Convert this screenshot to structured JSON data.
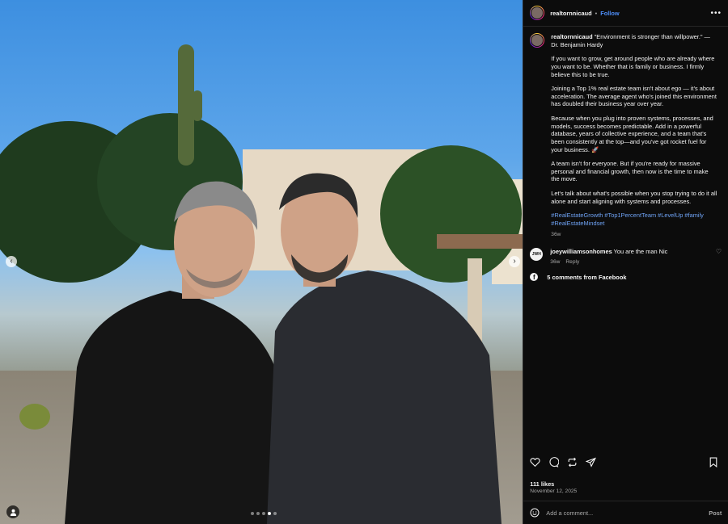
{
  "header": {
    "username": "realtornnicaud",
    "separator": "•",
    "follow_label": "Follow",
    "more_label": "•••"
  },
  "caption": {
    "username": "realtornnicaud",
    "quote": "\"Environment is stronger than willpower.\" — Dr. Benjamin Hardy",
    "paragraphs": [
      "If you want to grow, get around people who are already where you want to be. Whether that is family or business. I firmly believe this to be true.",
      "Joining a Top 1% real estate team isn't about ego — it's about acceleration. The average agent who's joined this environment has doubled their business year over year.",
      "Because when you plug into proven systems, processes, and models, success becomes predictable. Add in a powerful database, years of collective experience, and a team that's been consistently at the top—and you've got rocket fuel for your business. 🚀",
      "A team isn't for everyone. But if you're ready for massive personal and financial growth, then now is the time to make the move.",
      "Let's talk about what's possible when you stop trying to do it all alone and start aligning with systems and processes."
    ],
    "hashtags": "#RealEstateGrowth #Top1PercentTeam #LevelUp #family #RealEstateMindset",
    "age": "36w"
  },
  "comments": [
    {
      "avatar_text": "JWH",
      "username": "joeywilliamsonhomes",
      "text": "You are the man Nic",
      "age": "36w",
      "reply_label": "Reply"
    }
  ],
  "facebook": {
    "label": "5 comments from Facebook",
    "icon": "facebook-icon"
  },
  "actions": {
    "icons": [
      "heart-icon",
      "comment-icon",
      "share-icon",
      "send-icon",
      "bookmark-icon"
    ]
  },
  "stats": {
    "likes": "111 likes",
    "date": "November 12, 2025"
  },
  "add_comment": {
    "placeholder": "Add a comment...",
    "post_label": "Post"
  },
  "photo": {
    "nav_prev": "‹",
    "nav_next": "›",
    "carousel_count": 5,
    "carousel_active": 4
  },
  "colors": {
    "accent": "#4d8df7",
    "hashtag": "#6fa3f5",
    "bg": "#0c0c0c"
  }
}
